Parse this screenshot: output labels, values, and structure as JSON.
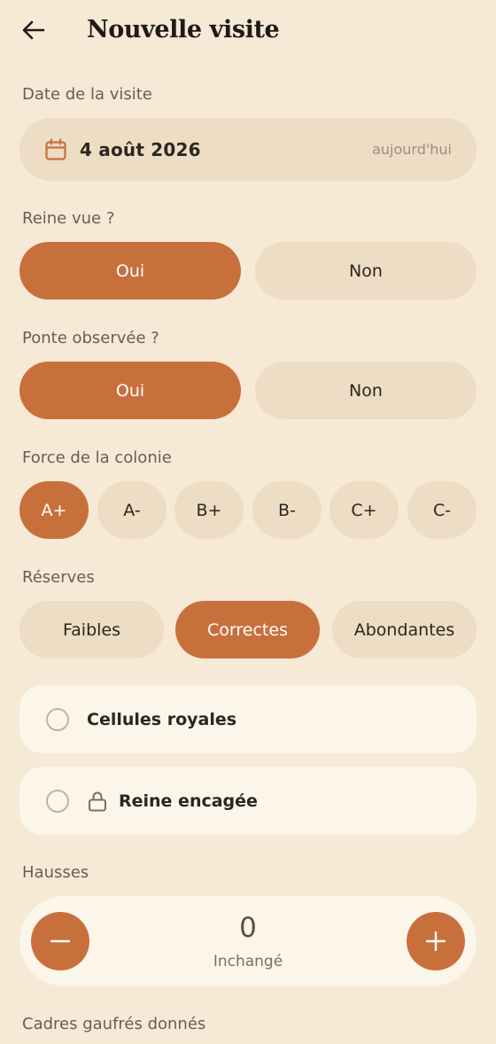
{
  "header": {
    "title": "Nouvelle visite"
  },
  "date": {
    "label": "Date de la visite",
    "value": "4 août 2026",
    "today_hint": "aujourd'hui"
  },
  "queen_seen": {
    "label": "Reine vue ?",
    "yes": "Oui",
    "no": "Non",
    "selected": "yes"
  },
  "laying": {
    "label": "Ponte observée ?",
    "yes": "Oui",
    "no": "Non",
    "selected": "yes"
  },
  "strength": {
    "label": "Force de la colonie",
    "options": [
      "A+",
      "A-",
      "B+",
      "B-",
      "C+",
      "C-"
    ],
    "selected": "A+"
  },
  "reserves": {
    "label": "Réserves",
    "options": [
      "Faibles",
      "Correctes",
      "Abondantes"
    ],
    "selected": "Correctes"
  },
  "checks": {
    "royal_cells": {
      "label": "Cellules royales",
      "checked": false
    },
    "queen_caged": {
      "label": "Reine encagée",
      "checked": false
    }
  },
  "supers": {
    "label": "Hausses",
    "value": "0",
    "status": "Inchangé"
  },
  "frames": {
    "label": "Cadres gaufrés donnés"
  },
  "colors": {
    "accent": "#C8703C",
    "background": "#F6E9D6",
    "pill_off": "#EDDDC4",
    "card": "#FBF5EA"
  }
}
